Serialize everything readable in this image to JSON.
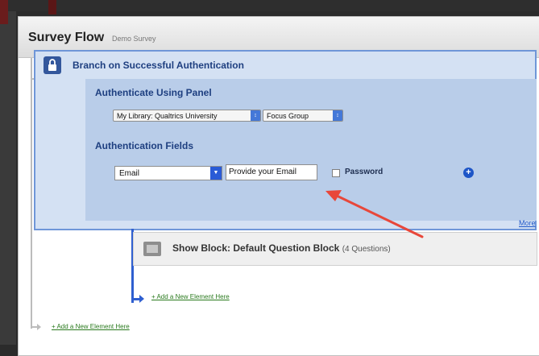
{
  "header": {
    "title": "Survey Flow",
    "subtitle": "Demo Survey"
  },
  "branch": {
    "title": "Branch on Successful Authentication",
    "auth_panel_label": "Authenticate Using Panel",
    "library_select": "My Library: Qualtrics University",
    "panel_select": "Focus Group",
    "auth_fields_label": "Authentication Fields",
    "field_type": "Email",
    "field_text": "Provide your Email",
    "password_label": "Password",
    "more_link": "More"
  },
  "show_block": {
    "title": "Show Block: Default Question Block",
    "count": "(4 Questions)"
  },
  "add_inner": "+ Add a New Element Here",
  "add_outer": "+ Add a New Element Here",
  "colors": {
    "accent": "#2f5fd0",
    "branch_bg": "#d4e1f3",
    "inner_bg": "#b9cde9",
    "arrow": "#e8473a"
  },
  "icons": [
    "lock-icon",
    "updown-arrows-icon",
    "dropdown-arrow-icon",
    "plus-icon",
    "block-icon"
  ]
}
